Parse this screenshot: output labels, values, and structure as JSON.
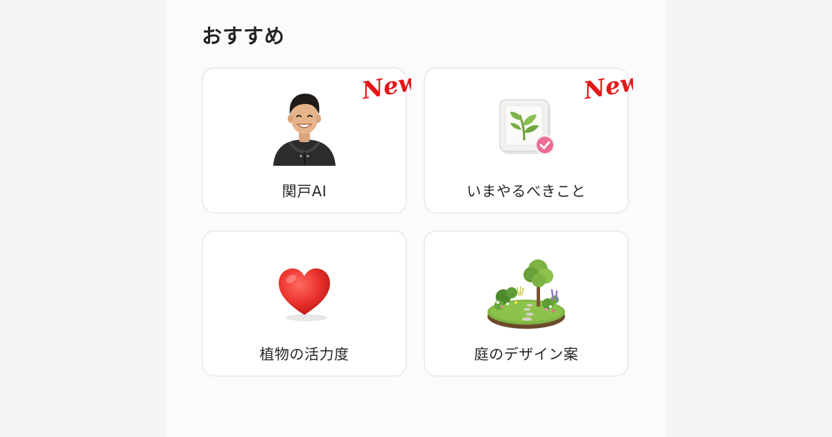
{
  "section": {
    "title": "おすすめ"
  },
  "cards": [
    {
      "label": "関戸AI",
      "icon": "person-avatar-icon",
      "badge": "New!"
    },
    {
      "label": "いまやるべきこと",
      "icon": "plant-task-check-icon",
      "badge": "New!"
    },
    {
      "label": "植物の活力度",
      "icon": "heart-icon"
    },
    {
      "label": "庭のデザイン案",
      "icon": "garden-design-icon"
    }
  ],
  "colors": {
    "badge": "#e41717",
    "card_border": "#ececef",
    "background": "#fbfbfc"
  }
}
